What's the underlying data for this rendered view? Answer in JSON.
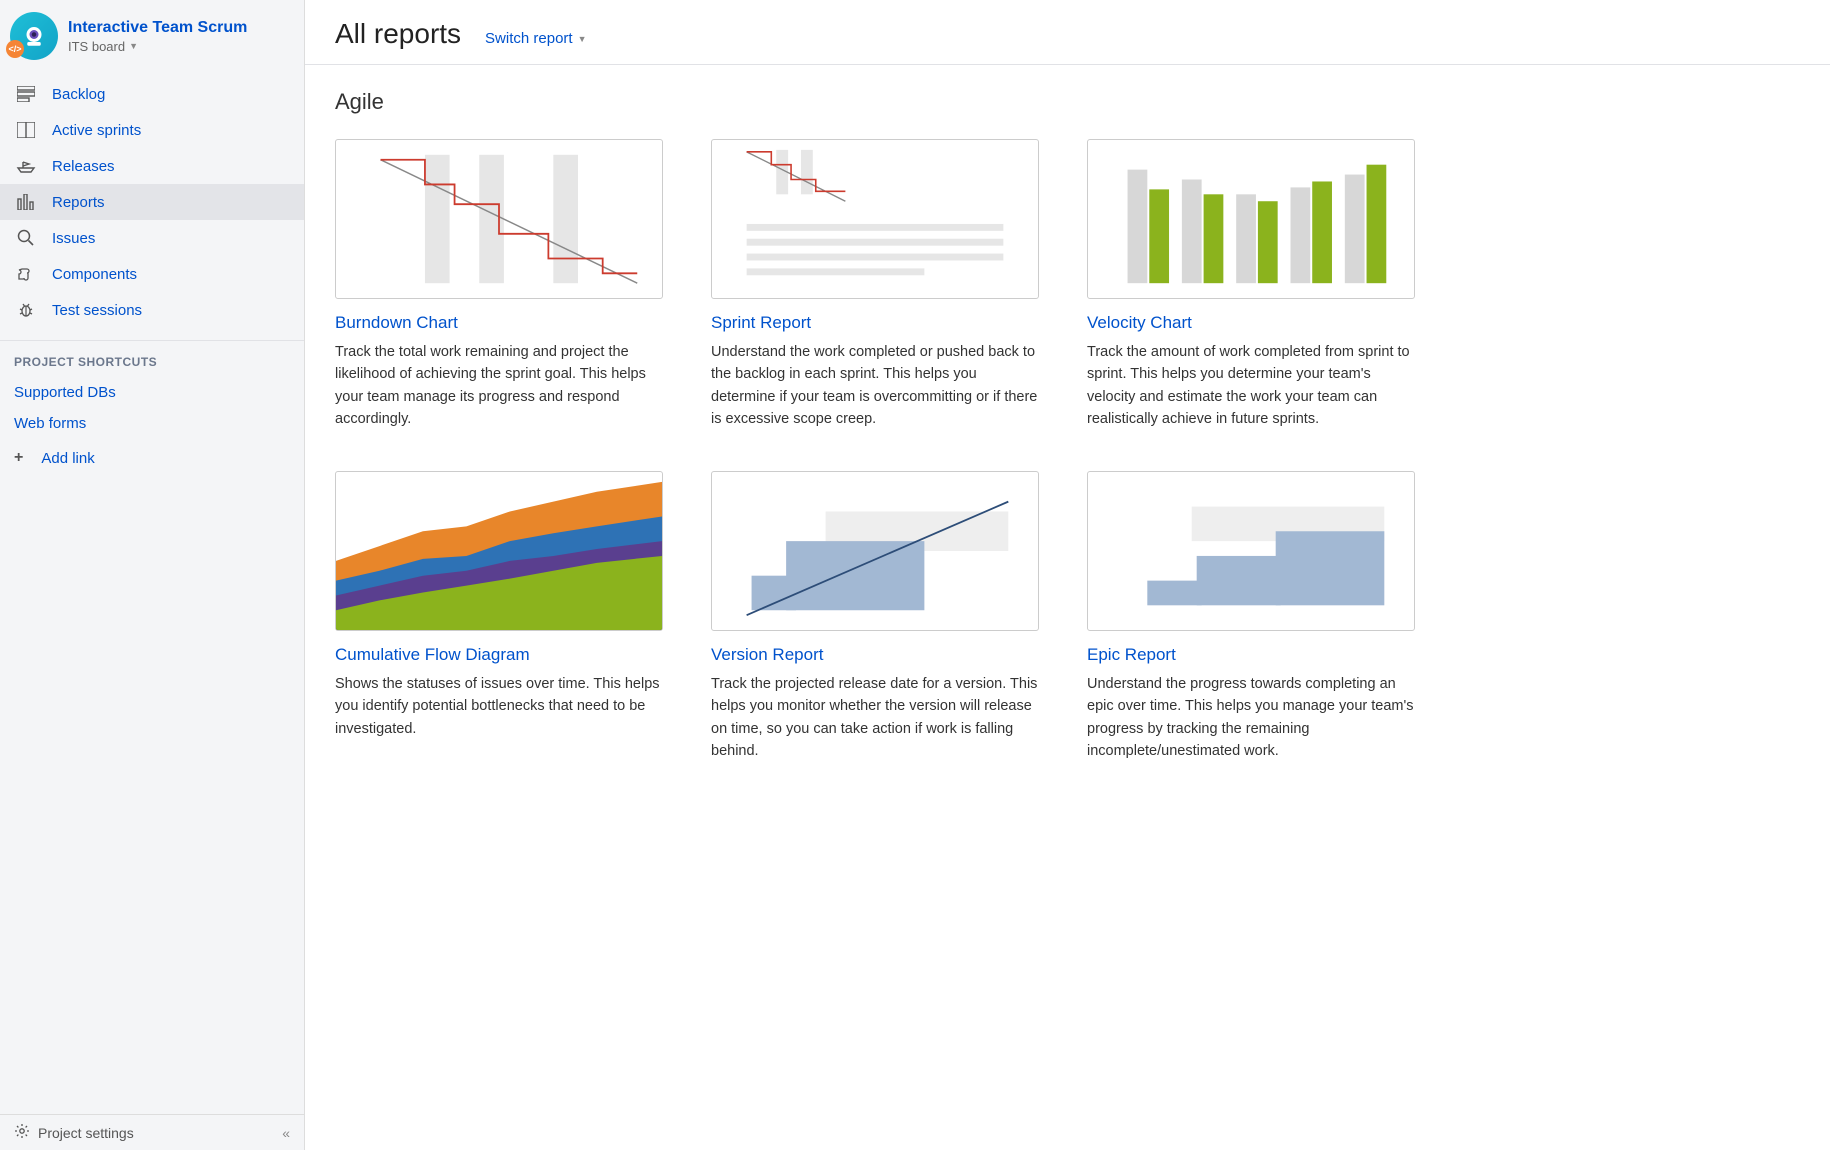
{
  "project": {
    "name": "Interactive Team Scrum",
    "board_label": "ITS board"
  },
  "nav": {
    "items": [
      {
        "id": "backlog",
        "label": "Backlog"
      },
      {
        "id": "active-sprints",
        "label": "Active sprints"
      },
      {
        "id": "releases",
        "label": "Releases"
      },
      {
        "id": "reports",
        "label": "Reports"
      },
      {
        "id": "issues",
        "label": "Issues"
      },
      {
        "id": "components",
        "label": "Components"
      },
      {
        "id": "test-sessions",
        "label": "Test sessions"
      }
    ],
    "shortcuts_heading": "PROJECT SHORTCUTS",
    "shortcuts": [
      {
        "label": "Supported DBs"
      },
      {
        "label": "Web forms"
      }
    ],
    "add_link_label": "Add link"
  },
  "footer": {
    "settings_label": "Project settings"
  },
  "header": {
    "title": "All reports",
    "switch_label": "Switch report"
  },
  "category": {
    "title": "Agile"
  },
  "reports": [
    {
      "id": "burndown",
      "title": "Burndown Chart",
      "desc": "Track the total work remaining and project the likelihood of achieving the sprint goal. This helps your team manage its progress and respond accordingly."
    },
    {
      "id": "sprint",
      "title": "Sprint Report",
      "desc": "Understand the work completed or pushed back to the backlog in each sprint. This helps you determine if your team is overcommitting or if there is excessive scope creep."
    },
    {
      "id": "velocity",
      "title": "Velocity Chart",
      "desc": "Track the amount of work completed from sprint to sprint. This helps you determine your team's velocity and estimate the work your team can realistically achieve in future sprints."
    },
    {
      "id": "cfd",
      "title": "Cumulative Flow Diagram",
      "desc": "Shows the statuses of issues over time. This helps you identify potential bottlenecks that need to be investigated."
    },
    {
      "id": "version",
      "title": "Version Report",
      "desc": "Track the projected release date for a version. This helps you monitor whether the version will release on time, so you can take action if work is falling behind."
    },
    {
      "id": "epic",
      "title": "Epic Report",
      "desc": "Understand the progress towards completing an epic over time. This helps you manage your team's progress by tracking the remaining incomplete/unestimated work."
    }
  ]
}
